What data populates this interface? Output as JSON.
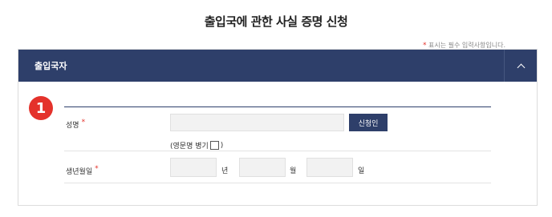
{
  "page": {
    "title": "출입국에 관한 사실 증명 신청"
  },
  "panel": {
    "title": "출입국자",
    "required_note": "표시는 필수 입력사항입니다.",
    "required_mark": "*"
  },
  "step_badge": "1",
  "form": {
    "name": {
      "label": "성명",
      "value": "",
      "auth_button": "신청인",
      "english_note": "(영문명 병기"
    },
    "birth": {
      "label": "생년월일",
      "year_unit": "년",
      "month_unit": "월",
      "day_unit": "일",
      "year_value": "",
      "month_value": "",
      "day_value": ""
    }
  },
  "colors": {
    "header": "#2e3f6a",
    "required": "#e4322b",
    "badge": "#e4322b"
  },
  "icons": {
    "toggle": "chevron-up-icon"
  }
}
